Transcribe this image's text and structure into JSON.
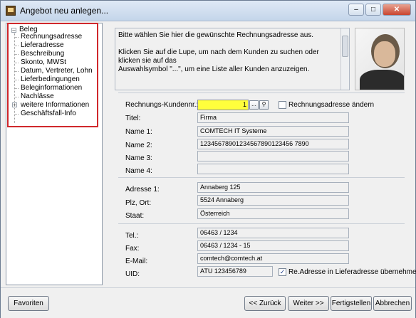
{
  "window": {
    "title": "Angebot neu anlegen..."
  },
  "tree": {
    "root": "Beleg",
    "items": [
      "Rechnungsadresse",
      "Lieferadresse",
      "Beschreibung",
      "Skonto, MWSt",
      "Datum, Vertreter, Lohn",
      "Lieferbedingungen",
      "Beleginformationen",
      "Nachlässe",
      "weitere Informationen",
      "Geschäftsfall-Info"
    ]
  },
  "info": {
    "text": "Bitte wählen Sie hier die gewünschte Rechnungsadresse aus.\n\nKlicken Sie auf die Lupe, um nach dem Kunden zu suchen oder klicken sie auf das\nAuswahlsymbol \"...\", um eine Liste aller Kunden anzuzeigen.\n\n\nKlicken Sie auf \"Weiter\", um den Vorgang fortzusetzen, oder auf"
  },
  "form": {
    "kundennr_label": "Rechnungs-Kundennr.:",
    "kundennr_value": "1",
    "ellipsis_label": "...",
    "change_label": "Rechnungsadresse ändern",
    "titel_label": "Titel:",
    "titel_value": "Firma",
    "name1_label": "Name 1:",
    "name1_value": "COMTECH IT Systeme",
    "name2_label": "Name 2:",
    "name2_value": "12345678901234567890123456 7890",
    "name3_label": "Name 3:",
    "name3_value": "",
    "name4_label": "Name 4:",
    "name4_value": "",
    "adresse1_label": "Adresse 1:",
    "adresse1_value": "Annaberg 125",
    "plzort_label": "Plz, Ort:",
    "plzort_value": "5524 Annaberg",
    "staat_label": "Staat:",
    "staat_value": "Österreich",
    "tel_label": "Tel.:",
    "tel_value": "06463 / 1234",
    "fax_label": "Fax:",
    "fax_value": "06463 / 1234 - 15",
    "email_label": "E-Mail:",
    "email_value": "comtech@comtech.at",
    "uid_label": "UID:",
    "uid_value": "ATU 123456789",
    "uebernehmen_label": "Re.Adresse in Lieferadresse übernehmen",
    "uebernehmen_checked": true
  },
  "buttons": {
    "favoriten": "Favoriten",
    "zurueck": "<< Zurück",
    "weiter": "Weiter >>",
    "fertigstellen": "Fertigstellen",
    "abbrechen": "Abbrechen"
  }
}
